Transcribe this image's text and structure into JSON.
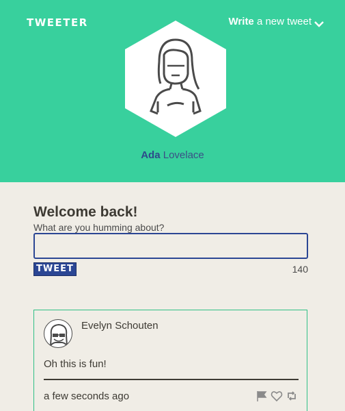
{
  "header": {
    "logo": "TWEETER",
    "write_bold": "Write",
    "write_rest": "a new tweet"
  },
  "profile": {
    "first_name": "Ada",
    "last_name": "Lovelace"
  },
  "composer": {
    "welcome": "Welcome back!",
    "prompt": "What are you humming about?",
    "input_value": "",
    "button_label": "TWEET",
    "remaining": "140"
  },
  "feed": [
    {
      "author": "Evelyn Schouten",
      "text": "Oh this is fun!",
      "time": "a few seconds ago"
    }
  ],
  "colors": {
    "hero": "#38d09d",
    "accent": "#2b4694",
    "background": "#f0ede6"
  },
  "icons": [
    "chevron-down-icon",
    "flag-icon",
    "heart-icon",
    "retweet-icon"
  ]
}
